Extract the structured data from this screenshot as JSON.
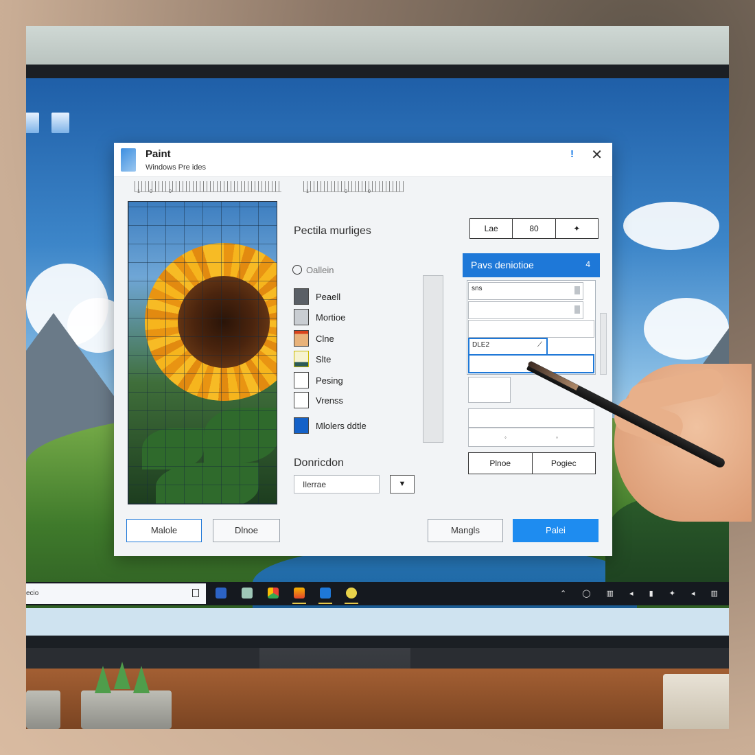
{
  "dialog": {
    "title": "Paint",
    "subtitle": "Windows Pre ides",
    "info_label": "!",
    "close_label": "✕"
  },
  "ruler": {
    "left_nums": [
      "1",
      "0",
      "0"
    ],
    "right_nums": [
      "1",
      "0",
      "0"
    ]
  },
  "left_panel": {
    "section_label": "Pectila murliges",
    "search_placeholder": "Oallein",
    "tools": [
      {
        "label": "Peaell",
        "color": "#5a5f66"
      },
      {
        "label": "Mortioe",
        "color": "#c9cdd2"
      },
      {
        "label": "Clne",
        "color": "#e8b27a"
      },
      {
        "label": "Slte",
        "color": "#f6f3d0"
      },
      {
        "label": "Pesing",
        "color": "#ffffff"
      },
      {
        "label": "Vrenss",
        "color": "#ffffff"
      },
      {
        "label": "Mlolers ddtle",
        "color": "#1461c8"
      }
    ],
    "decoration_label": "Donricdon",
    "decoration_value": "Ilerrae",
    "dropdown_icon": "▼"
  },
  "right_panel": {
    "segments": [
      "Lae",
      "80",
      "✦"
    ],
    "header_label": "Pavs deniotioe",
    "header_num": "4",
    "field_1": "sns",
    "field_2": "",
    "field_3": "",
    "selected_field": "DLE2",
    "selected_icon": "⟋",
    "bottom_small_1": "⬫",
    "bottom_small_2": "⬫",
    "pair_buttons": [
      "Plnoe",
      "Pogiec"
    ]
  },
  "footer": {
    "button_1": "Malole",
    "button_2": "Dlnoe",
    "button_3": "Mangls",
    "button_4": "Palei"
  },
  "desktop": {
    "icon_1": "",
    "icon_2": "",
    "search_text": "ecio"
  },
  "taskbar": {
    "tray": "⌃ ◯ ▥ ◂ ▮ ✦ ◂ ▥"
  },
  "colors": {
    "accent": "#1e78d8",
    "primary_button": "#1e8cf0"
  }
}
